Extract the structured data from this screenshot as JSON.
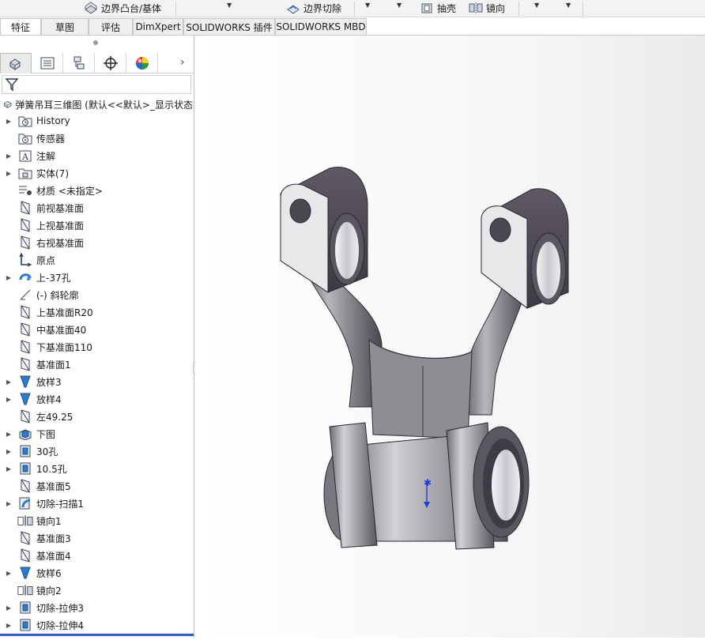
{
  "toolbar": {
    "boundary_boss": "边界凸台/基体",
    "boundary_cut": "边界切除",
    "shell": "抽壳",
    "mirror": "镜向"
  },
  "tabs": [
    {
      "label": "特征",
      "active": true
    },
    {
      "label": "草图"
    },
    {
      "label": "评估"
    },
    {
      "label": "DimXpert"
    },
    {
      "label": "SOLIDWORKS 插件"
    },
    {
      "label": "SOLIDWORKS MBD"
    }
  ],
  "panel": {
    "root_label": "弹簧吊耳三维图  (默认<<默认>_显示状态",
    "items": [
      {
        "label": "History",
        "icon": "history-folder-icon",
        "expandable": true
      },
      {
        "label": "传感器",
        "icon": "sensor-icon",
        "expandable": false
      },
      {
        "label": "注解",
        "icon": "annotation-icon",
        "expandable": true
      },
      {
        "label": "实体(7)",
        "icon": "solid-bodies-icon",
        "expandable": true
      },
      {
        "label": "材质 <未指定>",
        "icon": "material-icon",
        "expandable": false
      },
      {
        "label": "前视基准面",
        "icon": "plane-icon",
        "expandable": false
      },
      {
        "label": "上视基准面",
        "icon": "plane-icon",
        "expandable": false
      },
      {
        "label": "右视基准面",
        "icon": "plane-icon",
        "expandable": false
      },
      {
        "label": "原点",
        "icon": "origin-icon",
        "expandable": false
      },
      {
        "label": "上-37孔",
        "icon": "revolve-icon",
        "expandable": true
      },
      {
        "label": "(-) 斜轮廓",
        "icon": "sketch-icon",
        "expandable": false
      },
      {
        "label": "上基准面R20",
        "icon": "plane-icon",
        "expandable": false
      },
      {
        "label": "中基准面40",
        "icon": "plane-icon",
        "expandable": false
      },
      {
        "label": "下基准面110",
        "icon": "plane-icon",
        "expandable": false
      },
      {
        "label": "基准面1",
        "icon": "plane-icon",
        "expandable": false
      },
      {
        "label": "放样3",
        "icon": "loft-icon",
        "expandable": true
      },
      {
        "label": "放样4",
        "icon": "loft-icon",
        "expandable": true
      },
      {
        "label": "左49.25",
        "icon": "plane-icon",
        "expandable": false
      },
      {
        "label": "下图",
        "icon": "extrude-icon",
        "expandable": true
      },
      {
        "label": "30孔",
        "icon": "cut-extrude-icon",
        "expandable": true
      },
      {
        "label": "10.5孔",
        "icon": "cut-extrude-icon",
        "expandable": true
      },
      {
        "label": "基准面5",
        "icon": "plane-icon",
        "expandable": false
      },
      {
        "label": "切除-扫描1",
        "icon": "sweep-cut-icon",
        "expandable": true
      },
      {
        "label": "镜向1",
        "icon": "mirror-icon",
        "expandable": false
      },
      {
        "label": "基准面3",
        "icon": "plane-icon",
        "expandable": false
      },
      {
        "label": "基准面4",
        "icon": "plane-icon",
        "expandable": false
      },
      {
        "label": "放样6",
        "icon": "loft-icon",
        "expandable": true
      },
      {
        "label": "镜向2",
        "icon": "mirror-icon",
        "expandable": false
      },
      {
        "label": "切除-拉伸3",
        "icon": "cut-extrude-icon",
        "expandable": true
      },
      {
        "label": "切除-拉伸4",
        "icon": "cut-extrude-icon",
        "expandable": true
      }
    ]
  },
  "colors": {
    "accent": "#2e5fbf",
    "model_metal": "#8c8990",
    "model_dark": "#4a4650"
  }
}
